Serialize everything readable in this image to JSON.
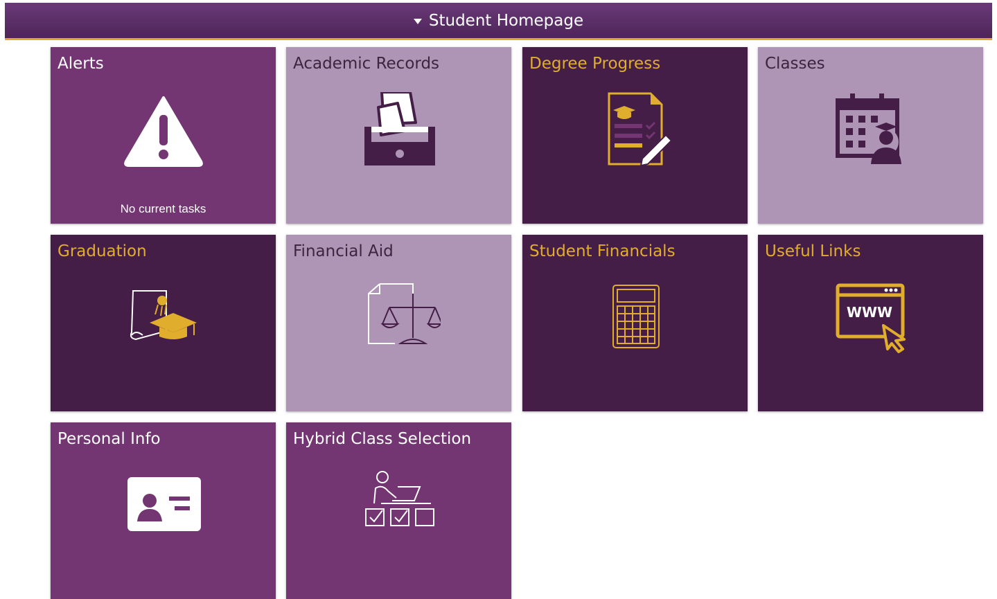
{
  "header": {
    "title": "Student Homepage"
  },
  "tiles": [
    {
      "name": "Alerts",
      "subtitle": "No current tasks"
    },
    {
      "name": "Academic Records"
    },
    {
      "name": "Degree Progress"
    },
    {
      "name": "Classes"
    },
    {
      "name": "Graduation"
    },
    {
      "name": "Financial Aid"
    },
    {
      "name": "Student Financials"
    },
    {
      "name": "Useful Links"
    },
    {
      "name": "Personal Info"
    },
    {
      "name": "Hybrid Class Selection"
    }
  ],
  "icons": [
    "warning-icon",
    "file-drawer-icon",
    "degree-checklist-icon",
    "class-calendar-icon",
    "diploma-cap-icon",
    "legal-scale-icon",
    "calculator-icon",
    "web-link-icon",
    "id-card-icon",
    "class-selection-icon"
  ],
  "colors": {
    "header": "#5c2c68",
    "accent_gold": "#e1ad2d",
    "tile_purple": "#733672",
    "tile_light": "#ae95b6",
    "tile_dark": "#451e48"
  }
}
